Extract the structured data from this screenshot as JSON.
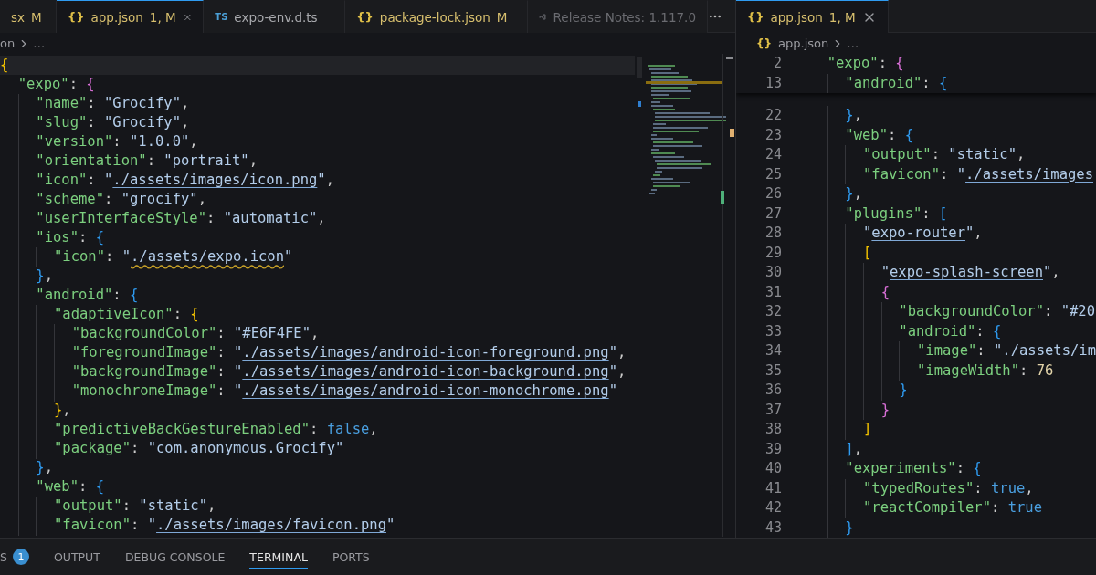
{
  "left_group": {
    "tabs": [
      {
        "label": "sx",
        "status": "M",
        "kind": "plain",
        "modified": true,
        "selected": false
      },
      {
        "icon": "{}",
        "label": "app.json",
        "status": "1, M",
        "kind": "json",
        "modified": true,
        "selected": true
      },
      {
        "icon": "TS",
        "label": "expo-env.d.ts",
        "kind": "ts",
        "modified": false,
        "selected": false
      },
      {
        "icon": "{}",
        "label": "package-lock.json",
        "status": "M",
        "kind": "json",
        "modified": true,
        "selected": false
      },
      {
        "label": "Release Notes: 1.117.0",
        "kind": "release",
        "selected": false
      }
    ],
    "breadcrumb": {
      "file": "on",
      "rest": "…"
    },
    "lines": [
      {
        "current": true,
        "tokens": [
          {
            "text": "{",
            "kind": "bracket1"
          }
        ]
      },
      {
        "current": false,
        "tokens": [
          {
            "text": "  \"expo\"",
            "kind": "key"
          },
          {
            "text": ": ",
            "kind": "punct"
          },
          {
            "text": "{",
            "kind": "bracket2"
          }
        ]
      },
      {
        "current": false,
        "tokens": [
          {
            "text": "    \"name\"",
            "kind": "key"
          },
          {
            "text": ": ",
            "kind": "punct"
          },
          {
            "text": "\"Grocify\"",
            "kind": "string"
          },
          {
            "text": ",",
            "kind": "punct"
          }
        ]
      },
      {
        "current": false,
        "tokens": [
          {
            "text": "    \"slug\"",
            "kind": "key"
          },
          {
            "text": ": ",
            "kind": "punct"
          },
          {
            "text": "\"Grocify\"",
            "kind": "string"
          },
          {
            "text": ",",
            "kind": "punct"
          }
        ]
      },
      {
        "current": false,
        "tokens": [
          {
            "text": "    \"version\"",
            "kind": "key"
          },
          {
            "text": ": ",
            "kind": "punct"
          },
          {
            "text": "\"1.0.0\"",
            "kind": "string"
          },
          {
            "text": ",",
            "kind": "punct"
          }
        ]
      },
      {
        "current": false,
        "tokens": [
          {
            "text": "    \"orientation\"",
            "kind": "key"
          },
          {
            "text": ": ",
            "kind": "punct"
          },
          {
            "text": "\"portrait\"",
            "kind": "string"
          },
          {
            "text": ",",
            "kind": "punct"
          }
        ]
      },
      {
        "current": false,
        "tokens": [
          {
            "text": "    \"icon\"",
            "kind": "key"
          },
          {
            "text": ": ",
            "kind": "punct"
          },
          {
            "text": "\"",
            "kind": "string"
          },
          {
            "text": "./assets/images/icon.png",
            "kind": "link"
          },
          {
            "text": "\"",
            "kind": "string"
          },
          {
            "text": ",",
            "kind": "punct"
          }
        ]
      },
      {
        "current": false,
        "tokens": [
          {
            "text": "    \"scheme\"",
            "kind": "key"
          },
          {
            "text": ": ",
            "kind": "punct"
          },
          {
            "text": "\"grocify\"",
            "kind": "string"
          },
          {
            "text": ",",
            "kind": "punct"
          }
        ]
      },
      {
        "current": false,
        "tokens": [
          {
            "text": "    \"userInterfaceStyle\"",
            "kind": "key"
          },
          {
            "text": ": ",
            "kind": "punct"
          },
          {
            "text": "\"automatic\"",
            "kind": "string"
          },
          {
            "text": ",",
            "kind": "punct"
          }
        ]
      },
      {
        "current": false,
        "tokens": [
          {
            "text": "    \"ios\"",
            "kind": "key"
          },
          {
            "text": ": ",
            "kind": "punct"
          },
          {
            "text": "{",
            "kind": "bracket3"
          }
        ]
      },
      {
        "current": false,
        "tokens": [
          {
            "text": "      \"icon\"",
            "kind": "key"
          },
          {
            "text": ": ",
            "kind": "punct"
          },
          {
            "text": "\"",
            "kind": "string"
          },
          {
            "text": "./assets/expo.icon",
            "kind": "warning"
          },
          {
            "text": "\"",
            "kind": "string"
          }
        ]
      },
      {
        "current": false,
        "tokens": [
          {
            "text": "    }",
            "kind": "bracket3"
          },
          {
            "text": ",",
            "kind": "punct"
          }
        ]
      },
      {
        "current": false,
        "tokens": [
          {
            "text": "    \"android\"",
            "kind": "key"
          },
          {
            "text": ": ",
            "kind": "punct"
          },
          {
            "text": "{",
            "kind": "bracket3"
          }
        ]
      },
      {
        "current": false,
        "tokens": [
          {
            "text": "      \"adaptiveIcon\"",
            "kind": "key"
          },
          {
            "text": ": ",
            "kind": "punct"
          },
          {
            "text": "{",
            "kind": "bracket1"
          }
        ]
      },
      {
        "current": false,
        "tokens": [
          {
            "text": "        \"backgroundColor\"",
            "kind": "key"
          },
          {
            "text": ": ",
            "kind": "punct"
          },
          {
            "text": "\"#E6F4FE\"",
            "kind": "string"
          },
          {
            "text": ",",
            "kind": "punct"
          }
        ]
      },
      {
        "current": false,
        "tokens": [
          {
            "text": "        \"foregroundImage\"",
            "kind": "key"
          },
          {
            "text": ": ",
            "kind": "punct"
          },
          {
            "text": "\"",
            "kind": "string"
          },
          {
            "text": "./assets/images/android-icon-foreground.png",
            "kind": "link"
          },
          {
            "text": "\"",
            "kind": "string"
          },
          {
            "text": ",",
            "kind": "punct"
          }
        ]
      },
      {
        "current": false,
        "tokens": [
          {
            "text": "        \"backgroundImage\"",
            "kind": "key"
          },
          {
            "text": ": ",
            "kind": "punct"
          },
          {
            "text": "\"",
            "kind": "string"
          },
          {
            "text": "./assets/images/android-icon-background.png",
            "kind": "link"
          },
          {
            "text": "\"",
            "kind": "string"
          },
          {
            "text": ",",
            "kind": "punct"
          }
        ]
      },
      {
        "current": false,
        "tokens": [
          {
            "text": "        \"monochromeImage\"",
            "kind": "key"
          },
          {
            "text": ": ",
            "kind": "punct"
          },
          {
            "text": "\"",
            "kind": "string"
          },
          {
            "text": "./assets/images/android-icon-monochrome.png",
            "kind": "link"
          },
          {
            "text": "\"",
            "kind": "string"
          }
        ]
      },
      {
        "current": false,
        "tokens": [
          {
            "text": "      }",
            "kind": "bracket1"
          },
          {
            "text": ",",
            "kind": "punct"
          }
        ]
      },
      {
        "current": false,
        "tokens": [
          {
            "text": "      \"predictiveBackGestureEnabled\"",
            "kind": "key"
          },
          {
            "text": ": ",
            "kind": "punct"
          },
          {
            "text": "false",
            "kind": "keyword"
          },
          {
            "text": ",",
            "kind": "punct"
          }
        ]
      },
      {
        "current": false,
        "tokens": [
          {
            "text": "      \"package\"",
            "kind": "key"
          },
          {
            "text": ": ",
            "kind": "punct"
          },
          {
            "text": "\"com.anonymous.Grocify\"",
            "kind": "string"
          }
        ]
      },
      {
        "current": false,
        "tokens": [
          {
            "text": "    }",
            "kind": "bracket3"
          },
          {
            "text": ",",
            "kind": "punct"
          }
        ]
      },
      {
        "current": false,
        "tokens": [
          {
            "text": "    \"web\"",
            "kind": "key"
          },
          {
            "text": ": ",
            "kind": "punct"
          },
          {
            "text": "{",
            "kind": "bracket3"
          }
        ]
      },
      {
        "current": false,
        "tokens": [
          {
            "text": "      \"output\"",
            "kind": "key"
          },
          {
            "text": ": ",
            "kind": "punct"
          },
          {
            "text": "\"static\"",
            "kind": "string"
          },
          {
            "text": ",",
            "kind": "punct"
          }
        ]
      },
      {
        "current": false,
        "tokens": [
          {
            "text": "      \"favicon\"",
            "kind": "key"
          },
          {
            "text": ": ",
            "kind": "punct"
          },
          {
            "text": "\"",
            "kind": "string"
          },
          {
            "text": "./assets/images/favicon.png",
            "kind": "link"
          },
          {
            "text": "\"",
            "kind": "string"
          }
        ]
      }
    ]
  },
  "right_group": {
    "tabs": [
      {
        "icon": "{}",
        "label": "app.json",
        "status": "1, M",
        "kind": "json",
        "modified": true,
        "selected": true
      }
    ],
    "breadcrumb": {
      "icon": "{}",
      "file": "app.json",
      "rest": "…"
    },
    "sticky": [
      {
        "n": "2",
        "tokens": [
          {
            "text": "  \"expo\"",
            "kind": "key"
          },
          {
            "text": ": ",
            "kind": "punct"
          },
          {
            "text": "{",
            "kind": "bracket2"
          }
        ]
      },
      {
        "n": "13",
        "tokens": [
          {
            "text": "    \"android\"",
            "kind": "key"
          },
          {
            "text": ": ",
            "kind": "punct"
          },
          {
            "text": "{",
            "kind": "bracket3"
          }
        ]
      }
    ],
    "lines": [
      {
        "n": "22",
        "tokens": [
          {
            "text": "    }",
            "kind": "bracket3"
          },
          {
            "text": ",",
            "kind": "punct"
          }
        ]
      },
      {
        "n": "23",
        "tokens": [
          {
            "text": "    \"web\"",
            "kind": "key"
          },
          {
            "text": ": ",
            "kind": "punct"
          },
          {
            "text": "{",
            "kind": "bracket3"
          }
        ]
      },
      {
        "n": "24",
        "tokens": [
          {
            "text": "      \"output\"",
            "kind": "key"
          },
          {
            "text": ": ",
            "kind": "punct"
          },
          {
            "text": "\"static\"",
            "kind": "string"
          },
          {
            "text": ",",
            "kind": "punct"
          }
        ]
      },
      {
        "n": "25",
        "tokens": [
          {
            "text": "      \"favicon\"",
            "kind": "key"
          },
          {
            "text": ": ",
            "kind": "punct"
          },
          {
            "text": "\"",
            "kind": "string"
          },
          {
            "text": "./assets/images",
            "kind": "link"
          }
        ]
      },
      {
        "n": "26",
        "tokens": [
          {
            "text": "    }",
            "kind": "bracket3"
          },
          {
            "text": ",",
            "kind": "punct"
          }
        ]
      },
      {
        "n": "27",
        "tokens": [
          {
            "text": "    \"plugins\"",
            "kind": "key"
          },
          {
            "text": ": ",
            "kind": "punct"
          },
          {
            "text": "[",
            "kind": "bracket3"
          }
        ]
      },
      {
        "n": "28",
        "tokens": [
          {
            "text": "      \"",
            "kind": "string"
          },
          {
            "text": "expo-router",
            "kind": "link"
          },
          {
            "text": "\"",
            "kind": "string"
          },
          {
            "text": ",",
            "kind": "punct"
          }
        ]
      },
      {
        "n": "29",
        "tokens": [
          {
            "text": "      [",
            "kind": "bracket1"
          }
        ]
      },
      {
        "n": "30",
        "tokens": [
          {
            "text": "        \"",
            "kind": "string"
          },
          {
            "text": "expo-splash-screen",
            "kind": "link"
          },
          {
            "text": "\"",
            "kind": "string"
          },
          {
            "text": ",",
            "kind": "punct"
          }
        ]
      },
      {
        "n": "31",
        "tokens": [
          {
            "text": "        {",
            "kind": "bracket2"
          }
        ]
      },
      {
        "n": "32",
        "tokens": [
          {
            "text": "          \"backgroundColor\"",
            "kind": "key"
          },
          {
            "text": ": ",
            "kind": "punct"
          },
          {
            "text": "\"#20",
            "kind": "string"
          }
        ]
      },
      {
        "n": "33",
        "tokens": [
          {
            "text": "          \"android\"",
            "kind": "key"
          },
          {
            "text": ": ",
            "kind": "punct"
          },
          {
            "text": "{",
            "kind": "bracket3"
          }
        ]
      },
      {
        "n": "34",
        "tokens": [
          {
            "text": "            \"image\"",
            "kind": "key"
          },
          {
            "text": ": ",
            "kind": "punct"
          },
          {
            "text": "\"./assets/im",
            "kind": "string"
          }
        ]
      },
      {
        "n": "35",
        "tokens": [
          {
            "text": "            \"imageWidth\"",
            "kind": "key"
          },
          {
            "text": ": ",
            "kind": "punct"
          },
          {
            "text": "76",
            "kind": "number"
          }
        ]
      },
      {
        "n": "36",
        "tokens": [
          {
            "text": "          }",
            "kind": "bracket3"
          }
        ]
      },
      {
        "n": "37",
        "tokens": [
          {
            "text": "        }",
            "kind": "bracket2"
          }
        ]
      },
      {
        "n": "38",
        "tokens": [
          {
            "text": "      ]",
            "kind": "bracket1"
          }
        ]
      },
      {
        "n": "39",
        "tokens": [
          {
            "text": "    ]",
            "kind": "bracket3"
          },
          {
            "text": ",",
            "kind": "punct"
          }
        ]
      },
      {
        "n": "40",
        "tokens": [
          {
            "text": "    \"experiments\"",
            "kind": "key"
          },
          {
            "text": ": ",
            "kind": "punct"
          },
          {
            "text": "{",
            "kind": "bracket3"
          }
        ]
      },
      {
        "n": "41",
        "tokens": [
          {
            "text": "      \"typedRoutes\"",
            "kind": "key"
          },
          {
            "text": ": ",
            "kind": "punct"
          },
          {
            "text": "true",
            "kind": "keyword"
          },
          {
            "text": ",",
            "kind": "punct"
          }
        ]
      },
      {
        "n": "42",
        "tokens": [
          {
            "text": "      \"reactCompiler\"",
            "kind": "key"
          },
          {
            "text": ": ",
            "kind": "punct"
          },
          {
            "text": "true",
            "kind": "keyword"
          }
        ]
      },
      {
        "n": "43",
        "tokens": [
          {
            "text": "    }",
            "kind": "bracket3"
          }
        ]
      }
    ]
  },
  "panel": {
    "tabs": [
      {
        "label": "S",
        "badge": "1",
        "selected": false
      },
      {
        "label": "OUTPUT",
        "selected": false
      },
      {
        "label": "DEBUG CONSOLE",
        "selected": false
      },
      {
        "label": "TERMINAL",
        "selected": true
      },
      {
        "label": "PORTS",
        "selected": false
      }
    ]
  }
}
